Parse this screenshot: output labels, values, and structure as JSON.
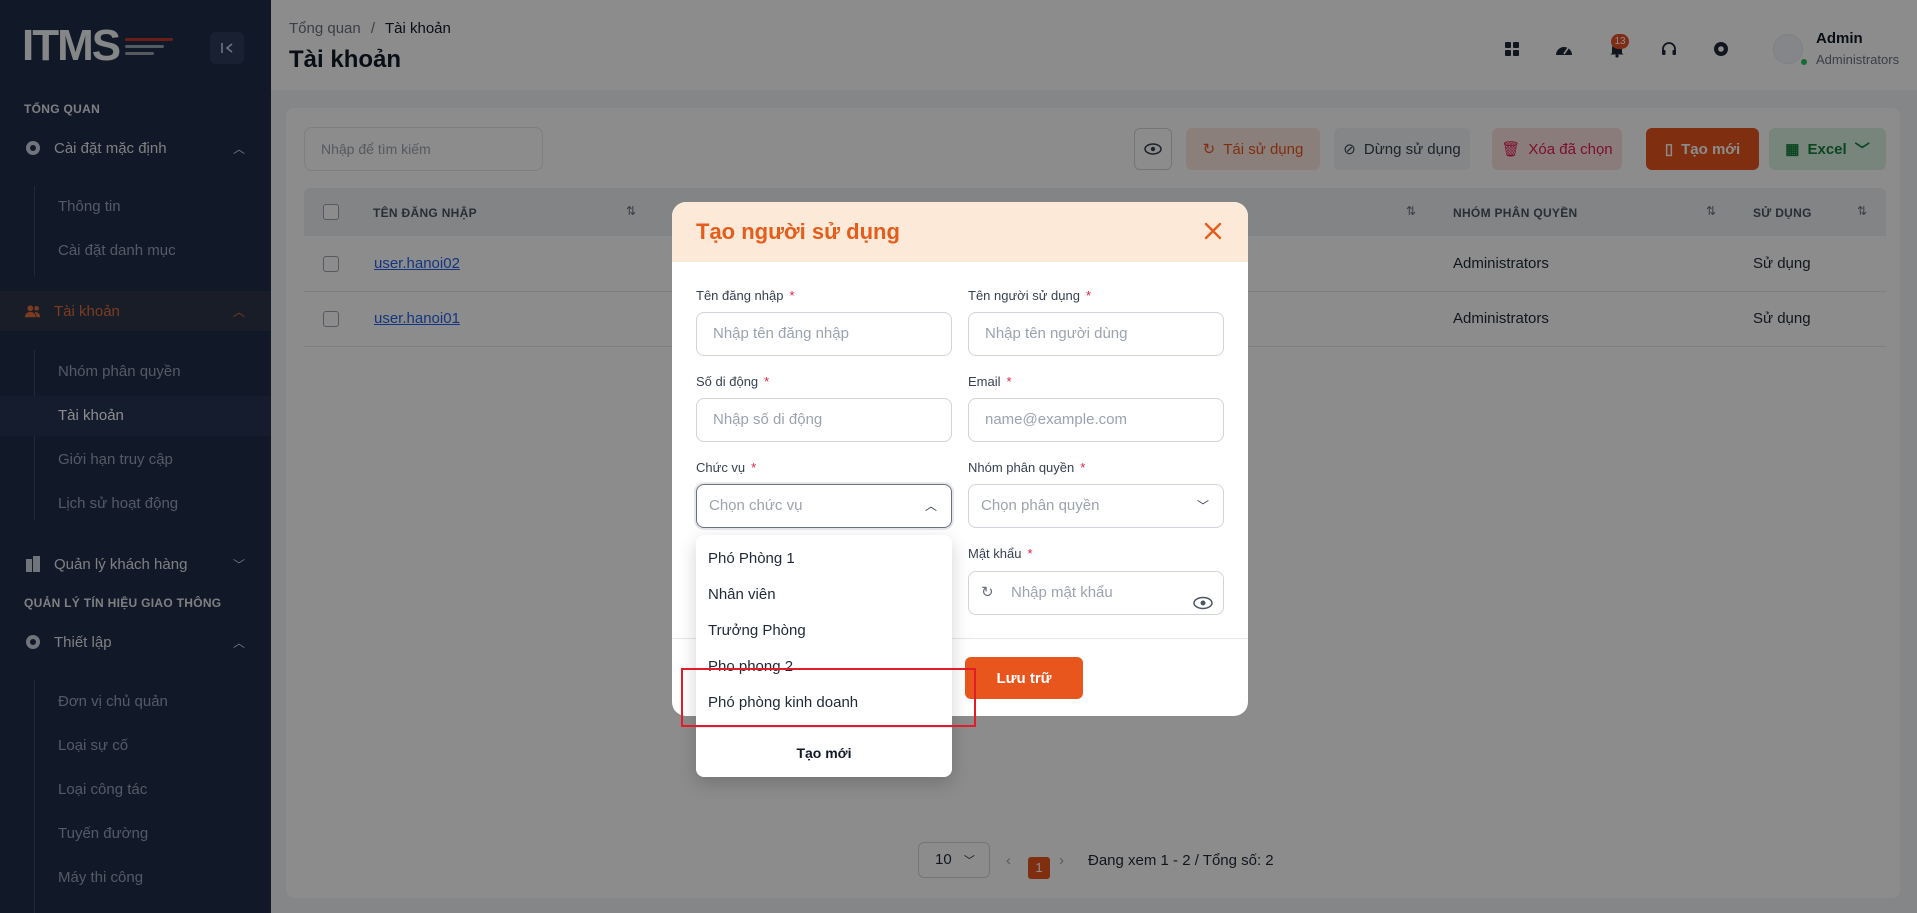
{
  "sidebar": {
    "logo_text": "ITMS",
    "section_overview": "TỔNG QUAN",
    "group_default_settings": "Cài đặt mặc định",
    "item_info": "Thông tin",
    "item_category_settings": "Cài đặt danh mục",
    "group_accounts": "Tài khoản",
    "item_permission_groups": "Nhóm phân quyền",
    "item_accounts": "Tài khoản",
    "item_access_limits": "Giới hạn truy cập",
    "item_activity_history": "Lịch sử hoạt động",
    "group_customer_management": "Quản lý khách hàng",
    "section_traffic_signals": "QUẢN LÝ TÍN HIỆU GIAO THÔNG",
    "group_setup": "Thiết lập",
    "item_owner_unit": "Đơn vị chủ quản",
    "item_incident_type": "Loại sự cố",
    "item_work_type": "Loại công tác",
    "item_route": "Tuyến đường",
    "item_construction_machine": "Máy thi công"
  },
  "header": {
    "breadcrumb_root": "Tổng quan",
    "breadcrumb_sep": "/",
    "breadcrumb_current": "Tài khoản",
    "page_title": "Tài khoản",
    "notification_count": "13",
    "user_name": "Admin",
    "user_role": "Administrators"
  },
  "toolbar": {
    "search_placeholder": "Nhập để tìm kiếm",
    "reuse_label": "Tái sử dụng",
    "stop_label": "Dừng sử dụng",
    "delete_label": "Xóa đã chọn",
    "create_label": "Tạo mới",
    "excel_label": "Excel"
  },
  "table": {
    "columns": [
      "TÊN ĐĂNG NHẬP",
      "NHÓM PHÂN QUYỀN",
      "SỬ DỤNG"
    ],
    "rows": [
      {
        "username": "user.hanoi02",
        "group": "Administrators",
        "status": "Sử dụng"
      },
      {
        "username": "user.hanoi01",
        "group": "Administrators",
        "status": "Sử dụng"
      }
    ]
  },
  "pagination": {
    "page_size": "10",
    "current_page": "1",
    "summary": "Đang xem 1 - 2 / Tổng số: 2"
  },
  "modal": {
    "title": "Tạo người sử dụng",
    "username_label": "Tên đăng nhập",
    "username_placeholder": "Nhập tên đăng nhập",
    "fullname_label": "Tên người sử dụng",
    "fullname_placeholder": "Nhập tên người dùng",
    "phone_label": "Số di động",
    "phone_placeholder": "Nhập số di động",
    "email_label": "Email",
    "email_placeholder": "name@example.com",
    "position_label": "Chức vụ",
    "position_placeholder": "Chọn chức vụ",
    "role_label": "Nhóm phân quyền",
    "role_placeholder": "Chọn phân quyền",
    "password_label": "Mật khẩu",
    "password_placeholder": "Nhập mật khẩu",
    "required_mark": "*",
    "save_label": "Lưu trữ"
  },
  "position_dropdown": {
    "options": [
      "Phó Phòng 1",
      "Nhân viên",
      "Trưởng Phòng",
      "Pho phong 2",
      "Phó phòng kinh doanh"
    ],
    "create_label": "Tạo mới"
  },
  "colors": {
    "accent": "#e8561d",
    "sidebar_bg": "#1f2d4a",
    "highlight_box": "#e11d2a"
  }
}
